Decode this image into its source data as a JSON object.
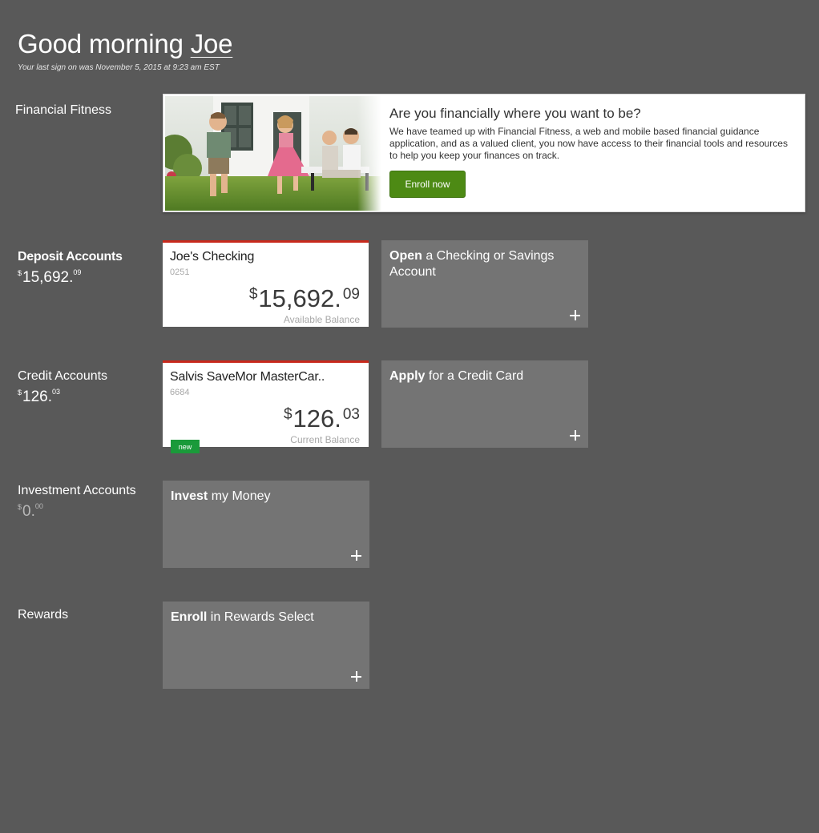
{
  "header": {
    "greeting": "Good morning",
    "user_name": "Joe",
    "last_signon": "Your last sign on was November 5, 2015 at 9:23 am EST"
  },
  "financial_fitness": {
    "label": "Financial Fitness",
    "banner_title": "Are you financially where you want to be?",
    "banner_text": "We have teamed up with Financial Fitness, a web and mobile based financial guidance application, and as a valued client, you now have access to their financial tools and resources to help you keep your finances on track.",
    "enroll_label": "Enroll now"
  },
  "deposit": {
    "label": "Deposit Accounts",
    "total_currency": "$",
    "total_whole": "15,692.",
    "total_cents": "09",
    "account": {
      "name": "Joe's Checking",
      "number": "0251",
      "currency": "$",
      "balance_whole": "15,692.",
      "balance_cents": "09",
      "balance_label": "Available Balance"
    },
    "open_tile": {
      "bold": "Open",
      "rest": " a Checking or Savings Account"
    }
  },
  "credit": {
    "label": "Credit Accounts",
    "total_currency": "$",
    "total_whole": "126.",
    "total_cents": "03",
    "account": {
      "name": "Salvis SaveMor MasterCar..",
      "number": "6684",
      "currency": "$",
      "balance_whole": "126.",
      "balance_cents": "03",
      "balance_label": "Current Balance",
      "badge": "new"
    },
    "apply_tile": {
      "bold": "Apply",
      "rest": " for a Credit Card"
    }
  },
  "investment": {
    "label": "Investment Accounts",
    "total_currency": "$",
    "total_whole": "0.",
    "total_cents": "00",
    "invest_tile": {
      "bold": "Invest",
      "rest": " my Money"
    }
  },
  "rewards": {
    "label": "Rewards",
    "enroll_tile": {
      "bold": "Enroll",
      "rest": " in Rewards Select"
    }
  },
  "colors": {
    "background": "#595959",
    "tile": "#747474",
    "accent_red": "#c8291c",
    "enroll_green": "#4d8a14",
    "badge_green": "#1a9a3a"
  }
}
